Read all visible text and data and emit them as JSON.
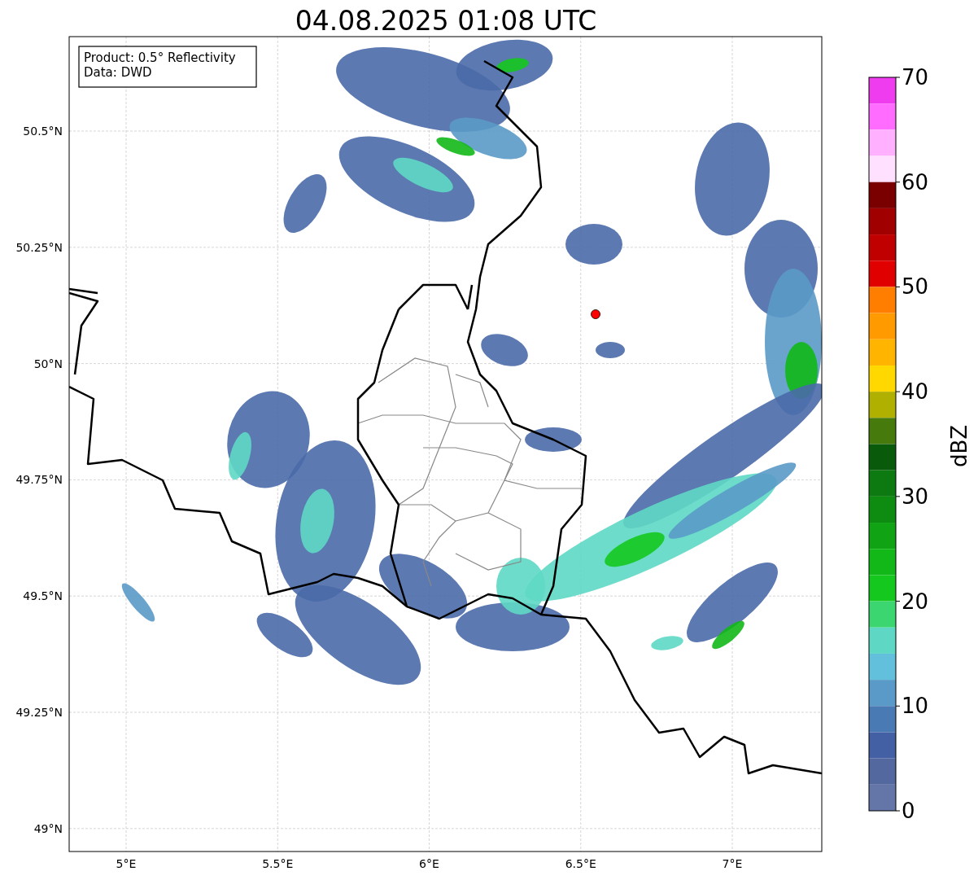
{
  "title": "04.08.2025 01:08 UTC",
  "map": {
    "legend": [
      "Product: 0.5° Reflectivity",
      "Data: DWD"
    ],
    "xticks": [
      "5°E",
      "5.5°E",
      "6°E",
      "6.5°E",
      "7°E"
    ],
    "yticks": [
      "50.5°N",
      "50.25°N",
      "50°N",
      "49.75°N",
      "49.5°N",
      "49.25°N",
      "49°N"
    ]
  },
  "colorbar": {
    "label": "dBZ",
    "ticks": [
      "70",
      "60",
      "50",
      "40",
      "30",
      "20",
      "10",
      "0"
    ],
    "segments": [
      {
        "color": "#ee3cee"
      },
      {
        "color": "#ff6cff"
      },
      {
        "color": "#ffb0ff"
      },
      {
        "color": "#ffe0ff"
      },
      {
        "color": "#7a0000"
      },
      {
        "color": "#a00000"
      },
      {
        "color": "#c00000"
      },
      {
        "color": "#e00000"
      },
      {
        "color": "#ff7e00"
      },
      {
        "color": "#ff9a00"
      },
      {
        "color": "#ffb400"
      },
      {
        "color": "#ffd800"
      },
      {
        "color": "#b0b000"
      },
      {
        "color": "#467a0c"
      },
      {
        "color": "#0a5a0c"
      },
      {
        "color": "#0c7a10"
      },
      {
        "color": "#0e8c12"
      },
      {
        "color": "#10a414"
      },
      {
        "color": "#12b818"
      },
      {
        "color": "#14c81e"
      },
      {
        "color": "#3cd670"
      },
      {
        "color": "#5ed8c4"
      },
      {
        "color": "#62c0dc"
      },
      {
        "color": "#5a9ac8"
      },
      {
        "color": "#4a7ab4"
      },
      {
        "color": "#4460a4"
      },
      {
        "color": "#5468a0"
      },
      {
        "color": "#6476a8"
      }
    ]
  }
}
